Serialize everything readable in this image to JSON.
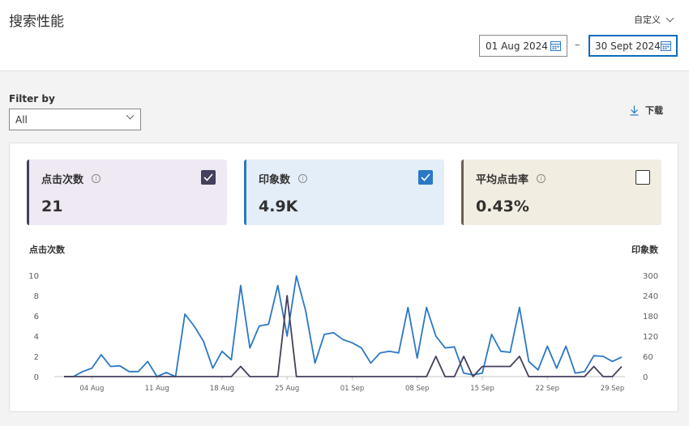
{
  "header": {
    "title": "搜索性能",
    "range_label": "自定义",
    "start_date": "01 Aug 2024",
    "end_date": "30 Sept 2024",
    "separator": "–"
  },
  "filter": {
    "label": "Filter by",
    "value": "All"
  },
  "download": {
    "label": "下载"
  },
  "metrics": [
    {
      "label": "点击次数",
      "value": "21",
      "checked": true,
      "color": "#45405c"
    },
    {
      "label": "印象数",
      "value": "4.9K",
      "checked": true,
      "color": "#2b78c5"
    },
    {
      "label": "平均点击率",
      "value": "0.43%",
      "checked": false,
      "color": "#6e6152"
    }
  ],
  "chart_data": {
    "type": "line",
    "left_axis_title": "点击次数",
    "right_axis_title": "印象数",
    "left_ylim": [
      0,
      10
    ],
    "right_ylim": [
      0,
      300
    ],
    "left_ticks": [
      "0",
      "2",
      "4",
      "6",
      "8",
      "10"
    ],
    "right_ticks": [
      "0",
      "60",
      "120",
      "180",
      "240",
      "300"
    ],
    "x_ticks": [
      {
        "label": "04 Aug",
        "index": 3
      },
      {
        "label": "11 Aug",
        "index": 10
      },
      {
        "label": "18 Aug",
        "index": 17
      },
      {
        "label": "25 Aug",
        "index": 24
      },
      {
        "label": "01 Sep",
        "index": 31
      },
      {
        "label": "08 Sep",
        "index": 38
      },
      {
        "label": "15 Sep",
        "index": 45
      },
      {
        "label": "22 Sep",
        "index": 52
      },
      {
        "label": "29 Sep",
        "index": 59
      }
    ],
    "series": [
      {
        "name": "印象数",
        "axis": "right",
        "color": "#2b78c5",
        "values": [
          0,
          0,
          15,
          25,
          65,
          30,
          32,
          15,
          15,
          45,
          0,
          12,
          0,
          185,
          150,
          105,
          25,
          75,
          50,
          270,
          85,
          150,
          155,
          270,
          120,
          298,
          195,
          40,
          125,
          130,
          110,
          100,
          85,
          40,
          70,
          75,
          70,
          205,
          55,
          205,
          120,
          85,
          88,
          10,
          5,
          10,
          125,
          75,
          72,
          205,
          45,
          20,
          90,
          25,
          90,
          10,
          15,
          62,
          60,
          45,
          58
        ]
      },
      {
        "name": "点击次数",
        "axis": "left",
        "color": "#45405c",
        "values": [
          0,
          0,
          0,
          0,
          0,
          0,
          0,
          0,
          0,
          0,
          0,
          0,
          0,
          0,
          0,
          0,
          0,
          0,
          0,
          1,
          0,
          0,
          0,
          0,
          8,
          0,
          0,
          0,
          0,
          0,
          0,
          0,
          0,
          0,
          0,
          0,
          0,
          0,
          0,
          0,
          2,
          0,
          0,
          2,
          0,
          1,
          1,
          1,
          1,
          2,
          0,
          0,
          0,
          0,
          0,
          0,
          0,
          1,
          0,
          0,
          1
        ]
      }
    ]
  }
}
